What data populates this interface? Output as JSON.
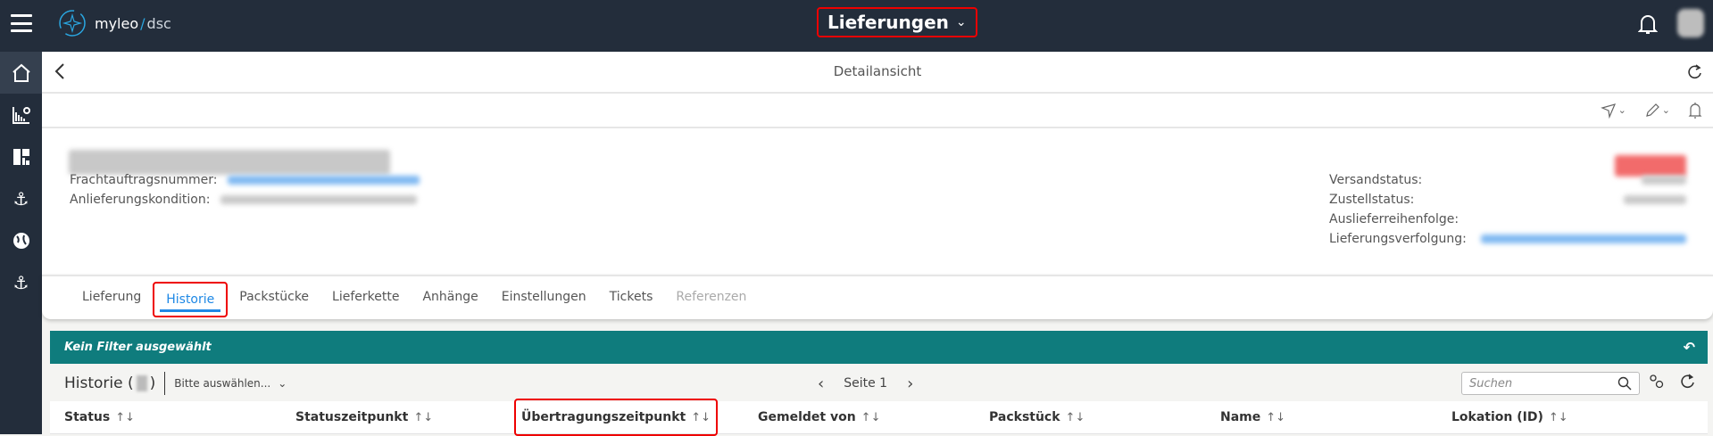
{
  "topbar": {
    "logo_brand": "myleo",
    "logo_separator": "/",
    "logo_product": "dsc",
    "app_title": "Lieferungen"
  },
  "header": {
    "title": "Detailansicht"
  },
  "info": {
    "left": [
      {
        "label": "Frachtauftragsnummer:"
      },
      {
        "label": "Anlieferungskondition:"
      }
    ],
    "right": [
      {
        "label": "Versandstatus:"
      },
      {
        "label": "Zustellstatus:"
      },
      {
        "label": "Auslieferreihenfolge:"
      },
      {
        "label": "Lieferungsverfolgung:"
      }
    ]
  },
  "tabs": [
    {
      "label": "Lieferung"
    },
    {
      "label": "Historie"
    },
    {
      "label": "Packstücke"
    },
    {
      "label": "Lieferkette"
    },
    {
      "label": "Anhänge"
    },
    {
      "label": "Einstellungen"
    },
    {
      "label": "Tickets"
    },
    {
      "label": "Referenzen"
    }
  ],
  "filter": {
    "text": "Kein Filter ausgewählt"
  },
  "history": {
    "title": "Historie (",
    "title_close": ")",
    "select_placeholder": "Bitte auswählen...",
    "page_label": "Seite 1",
    "search_placeholder": "Suchen"
  },
  "table": {
    "columns": [
      "Status",
      "Statuszeitpunkt",
      "Übertragungszeitpunkt",
      "Gemeldet von",
      "Packstück",
      "Name",
      "Lokation (ID)"
    ],
    "sort_glyph": "↑↓"
  },
  "colors": {
    "topbar": "#232d3b",
    "accent": "#1e88e5",
    "filterbar": "#0f7c7d",
    "highlight": "#e00000"
  }
}
